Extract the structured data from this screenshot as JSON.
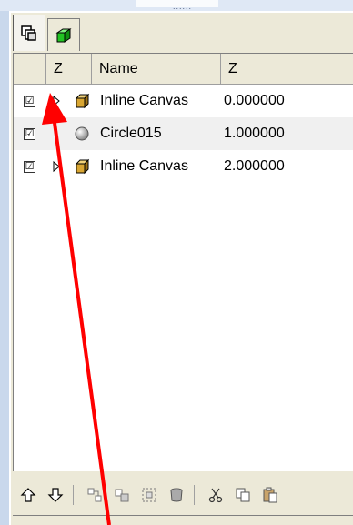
{
  "tabs": [
    {
      "icon": "layers-icon",
      "active": true
    },
    {
      "icon": "green-cube-icon",
      "active": false
    }
  ],
  "columns": {
    "z_left": "Z",
    "name": "Name",
    "z_right": "Z"
  },
  "rows": [
    {
      "checked": true,
      "check_glyph": "☑",
      "expandable": true,
      "icon": "box-icon",
      "name": "Inline Canvas",
      "z": "0.000000"
    },
    {
      "checked": true,
      "check_glyph": "☑",
      "expandable": false,
      "icon": "circle-icon",
      "name": "Circle015",
      "z": "1.000000"
    },
    {
      "checked": true,
      "check_glyph": "☑",
      "expandable": true,
      "icon": "box-icon",
      "name": "Inline Canvas",
      "z": "2.000000"
    }
  ],
  "toolbar": [
    "move-up-icon",
    "move-down-icon",
    "group-icon",
    "ungroup-icon",
    "select-icon",
    "delete-icon",
    "cut-icon",
    "copy-icon",
    "paste-icon"
  ],
  "annotation": {
    "color": "#ff0000"
  },
  "colors": {
    "panel": "#ece9d8",
    "list_bg": "#ffffff",
    "alt_row": "#f0f0f0"
  }
}
